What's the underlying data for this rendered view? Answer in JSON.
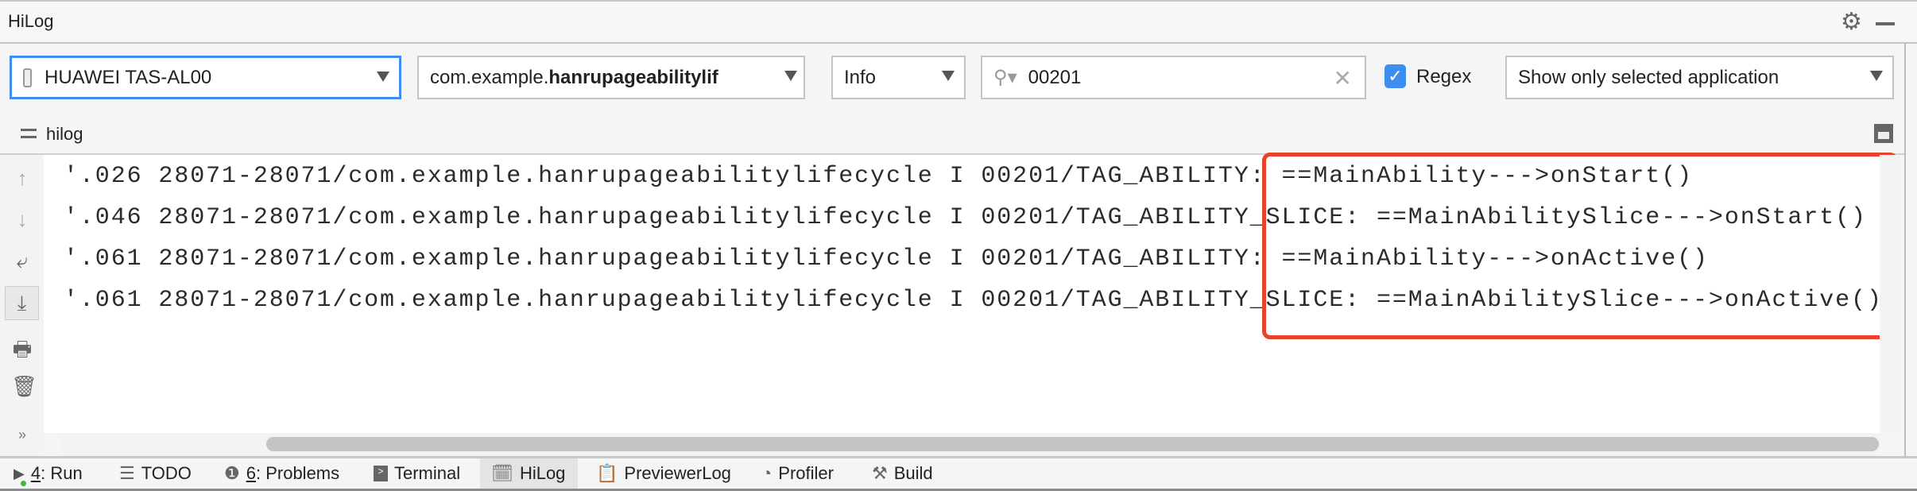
{
  "window": {
    "title": "HiLog"
  },
  "toolbar": {
    "device": "HUAWEI TAS-AL00",
    "package_prefix": "com.example.",
    "package_bold": "hanrupageabilitylif",
    "level": "Info",
    "search_value": "00201",
    "regex_label": "Regex",
    "regex_checked": true,
    "filter": "Show only selected application"
  },
  "subheader": {
    "label": "hilog"
  },
  "log": {
    "lines": [
      {
        "prefix": "'.026 28071-28071/com.example.hanrupageabilitylifecycle I 00201/TAG_ABILITY: ",
        "message": "==MainAbility--->onStart()"
      },
      {
        "prefix": "'.046 28071-28071/com.example.hanrupageabilitylifecycle I 00201/TAG_ABILITY_SLICE: ",
        "message": "==MainAbilitySlice--->onStart()"
      },
      {
        "prefix": "'.061 28071-28071/com.example.hanrupageabilitylifecycle I 00201/TAG_ABILITY: ",
        "message": "==MainAbility--->onActive()"
      },
      {
        "prefix": "'.061 28071-28071/com.example.hanrupageabilitylifecycle I 00201/TAG_ABILITY_SLICE: ",
        "message": "==MainAbilitySlice--->onActive()"
      }
    ],
    "highlight_color": "#e8412c"
  },
  "bottom_tabs": [
    {
      "key": "4",
      "label": ": Run"
    },
    {
      "label": "TODO"
    },
    {
      "key": "6",
      "label": ": Problems"
    },
    {
      "label": "Terminal"
    },
    {
      "label": "HiLog",
      "active": true
    },
    {
      "label": "PreviewerLog"
    },
    {
      "label": "Profiler"
    },
    {
      "label": "Build"
    }
  ],
  "colors": {
    "accent": "#3d8ef0",
    "checkbox": "#3d8ef0",
    "highlight": "#e8412c"
  }
}
